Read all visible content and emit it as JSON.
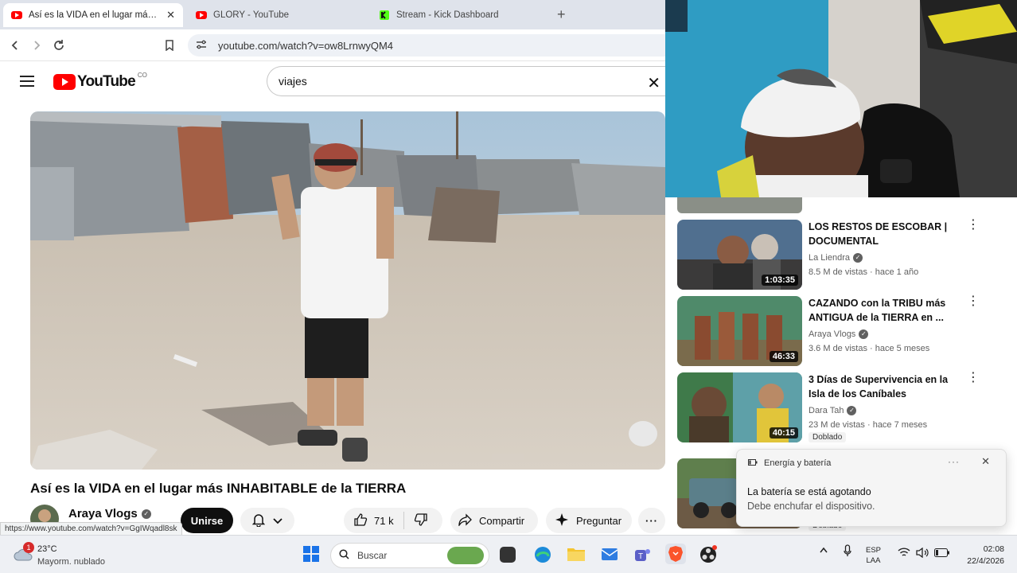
{
  "browser": {
    "tabs": [
      {
        "title": "Así es la VIDA en el lugar más INHABITABLE",
        "active": true,
        "icon": "youtube-icon"
      },
      {
        "title": "GLORY - YouTube",
        "active": false,
        "icon": "youtube-icon"
      },
      {
        "title": "Stream - Kick Dashboard",
        "active": false,
        "icon": "kick-icon"
      }
    ],
    "url": "youtube.com/watch?v=ow8LrnwyQM4",
    "status_url": "https://www.youtube.com/watch?v=GgIWqadl8sk"
  },
  "youtube": {
    "logo_text": "YouTube",
    "country_code": "CO",
    "search_value": "viajes",
    "video": {
      "title": "Así es la VIDA en el lugar más INHABITABLE de la TIERRA",
      "channel": "Araya Vlogs",
      "join_label": "Unirse",
      "likes": "71 k",
      "share_label": "Compartir",
      "ask_label": "Preguntar"
    },
    "recommendations": [
      {
        "title": "LOS RESTOS DE ESCOBAR | DOCUMENTAL",
        "channel": "La Liendra",
        "meta": "8.5 M de vistas · hace 1 año",
        "duration": "1:03:35"
      },
      {
        "title": "CAZANDO con la TRIBU más ANTIGUA de la TIERRA en ...",
        "channel": "Araya Vlogs",
        "meta": "3.6 M de vistas · hace 5 meses",
        "duration": "46:33"
      },
      {
        "title": "3 Días de Supervivencia en la Isla de los Caníbales",
        "channel": "Dara Tah",
        "meta": "23 M de vistas · hace 7 meses",
        "duration": "40:15",
        "badge": "Doblado"
      },
      {
        "badge": "Doblado"
      }
    ]
  },
  "notification": {
    "header": "Energía y batería",
    "line1": "La batería se está agotando",
    "line2": "Debe enchufar el dispositivo."
  },
  "taskbar": {
    "weather_temp": "23°C",
    "weather_desc": "Mayorm. nublado",
    "weather_badge": "1",
    "search_placeholder": "Buscar",
    "lang_top": "ESP",
    "lang_bottom": "LAA",
    "time": "02:08",
    "date": "22/4/2026"
  },
  "colors": {
    "youtube_red": "#ff0000",
    "join_bg": "#0f0f0f",
    "taskbar_bg": "#eef0f4"
  }
}
